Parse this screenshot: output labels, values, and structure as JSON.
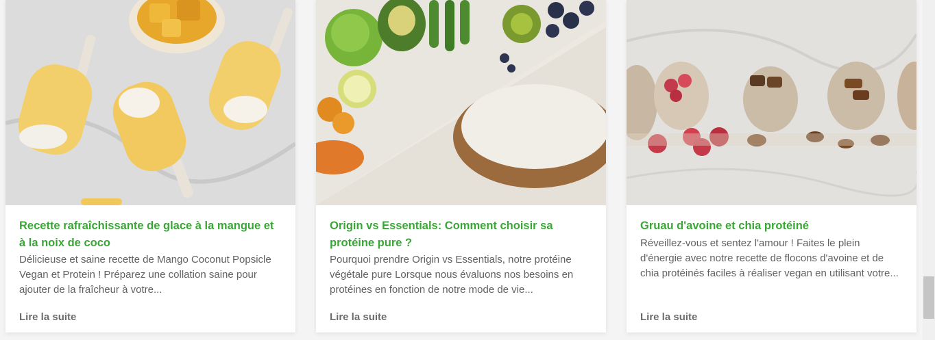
{
  "posts": [
    {
      "title": "Recette rafraîchissante de glace à la mangue et à la noix de coco",
      "excerpt": "Délicieuse et saine recette de Mango Coconut Popsicle Vegan et Protein ! Préparez une collation saine pour ajouter de la fraîcheur à votre...",
      "read_more": "Lire la suite",
      "image": "mango-coconut-popsicles-photo"
    },
    {
      "title": "Origin vs Essentials: Comment choisir sa protéine pure ?",
      "excerpt": "Pourquoi prendre Origin vs Essentials, notre protéine végétale pure Lorsque nous évaluons nos besoins en protéines en fonction de notre mode de vie...",
      "read_more": "Lire la suite",
      "image": "fruits-and-rice-photo"
    },
    {
      "title": "Gruau d'avoine et chia protéiné",
      "excerpt": "Réveillez-vous et sentez l'amour ! Faites le plein d'énergie avec notre recette de flocons d'avoine et de chia protéinés faciles à réaliser vegan en utilisant votre...",
      "read_more": "Lire la suite",
      "image": "oatmeal-chia-jars-photo"
    }
  ],
  "colors": {
    "title": "#3aa637",
    "text": "#616161",
    "read_more": "#6c6c6c"
  }
}
